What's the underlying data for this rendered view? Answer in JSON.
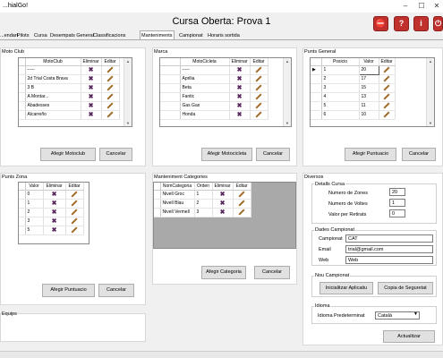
{
  "window": {
    "title": "...hialGo!"
  },
  "header": {
    "title": "Cursa Oberta: Prova 1",
    "buttons": [
      "⛔",
      "?",
      "i",
      "⏻"
    ]
  },
  "tabs": [
    "...endari",
    "Pilots",
    "Cursa",
    "Desempats General",
    "Classificacions",
    "Manteniments",
    "Campionat",
    "Horaris sortida"
  ],
  "moto_club": {
    "label": "Moto Club",
    "columns": [
      "MotoClub",
      "Eliminar",
      "Editar"
    ],
    "rows": [
      "-----",
      "2d Trial Costa Brava",
      "3 B",
      "A Montar...",
      "Abadesses",
      "Alcarreño"
    ],
    "add_button": "Afegir Motoclub",
    "cancel_button": "Cancelar"
  },
  "marca": {
    "label": "Marca",
    "columns": [
      "MotoCicleta",
      "Eliminar",
      "Editar"
    ],
    "rows": [
      "-----",
      "Aprilia",
      "Beta",
      "Fantic",
      "Gas Gas",
      "Honda"
    ],
    "add_button": "Afegir Motocicleta",
    "cancel_button": "Cancelar"
  },
  "punts_general": {
    "label": "Punts General",
    "columns": [
      "Posicio",
      "Valor",
      "Editar"
    ],
    "rows": [
      {
        "pos": "1",
        "val": "20"
      },
      {
        "pos": "2",
        "val": "17"
      },
      {
        "pos": "3",
        "val": "15"
      },
      {
        "pos": "4",
        "val": "13"
      },
      {
        "pos": "5",
        "val": "11"
      },
      {
        "pos": "6",
        "val": "10"
      }
    ],
    "add_button": "Afegir Puntuacio",
    "cancel_button": "Cancelar"
  },
  "punts_zona": {
    "label": "Punts Zona",
    "columns": [
      "Valor",
      "Eliminar",
      "Editar"
    ],
    "rows": [
      "0",
      "1",
      "2",
      "3",
      "5"
    ],
    "add_button": "Afegir Puntuacio",
    "cancel_button": "Cancelar"
  },
  "categories": {
    "label": "Manteniment Categories",
    "columns": [
      "NomCategoria",
      "Orden",
      "Eliminar",
      "Editar"
    ],
    "rows": [
      {
        "name": "Nivell Groc",
        "order": "1"
      },
      {
        "name": "Nivell Blau",
        "order": "2"
      },
      {
        "name": "Nivell Vermell",
        "order": "3"
      }
    ],
    "add_button": "Afegir Categoria",
    "cancel_button": "Cancelar"
  },
  "equips": {
    "label": "Equips"
  },
  "diversos": {
    "label": "Diversos",
    "detalls": {
      "label": "Detalls Cursa",
      "zones_label": "Numero de Zones",
      "zones": "20",
      "voltes_label": "Numero de Voltes",
      "voltes": "1",
      "retirat_label": "Valor per Retirats",
      "retirat": "0"
    },
    "dades": {
      "label": "Dades Campionat",
      "campionat_label": "Campionat",
      "campionat": "CAT",
      "email_label": "Email",
      "email": "trial@gmail.com",
      "web_label": "Web",
      "web": "Web"
    },
    "nou": {
      "label": "Nou Campionat",
      "init_button": "Inicialitzar Aplicatiu",
      "backup_button": "Copia de Seguretat"
    },
    "idioma": {
      "label": "Idioma",
      "predeterminat_label": "Idioma Predeterminat",
      "value": "Català"
    },
    "update_button": "Actualitzar"
  }
}
